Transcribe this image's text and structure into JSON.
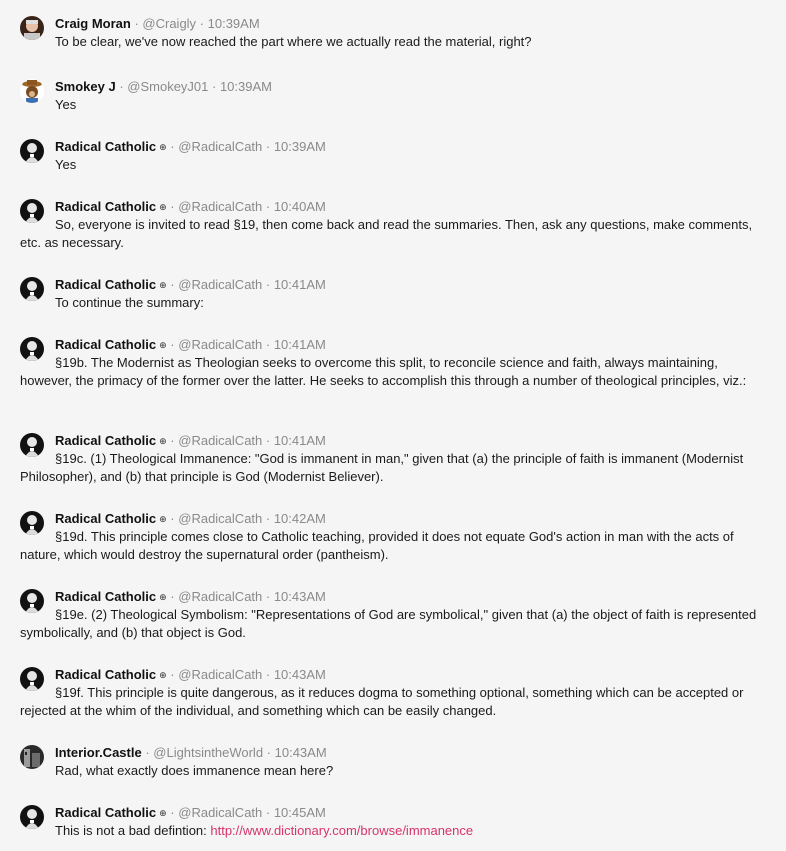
{
  "posts": [
    {
      "author": "Craig Moran",
      "badge": "",
      "handle": "@Craigly",
      "time": "10:39AM",
      "avatar": "craig-avatar",
      "text": "To be clear, we've now reached the part where we actually read the material, right?"
    },
    {
      "author": "Smokey J",
      "badge": "",
      "handle": "@SmokeyJ01",
      "time": "10:39AM",
      "avatar": "smokey-bear-avatar",
      "text": "Yes"
    },
    {
      "author": "Radical Catholic",
      "badge": "⊕",
      "handle": "@RadicalCath",
      "time": "10:39AM",
      "avatar": "priest-avatar",
      "text": "Yes"
    },
    {
      "author": "Radical Catholic",
      "badge": "⊕",
      "handle": "@RadicalCath",
      "time": "10:40AM",
      "avatar": "priest-avatar",
      "text": "So, everyone is invited to read §19, then come back and read the summaries. Then, ask any questions, make comments, etc. as necessary."
    },
    {
      "author": "Radical Catholic",
      "badge": "⊕",
      "handle": "@RadicalCath",
      "time": "10:41AM",
      "avatar": "priest-avatar",
      "text": "To continue the summary:"
    },
    {
      "author": "Radical Catholic",
      "badge": "⊕",
      "handle": "@RadicalCath",
      "time": "10:41AM",
      "avatar": "priest-avatar",
      "text": "§19b. The Modernist as Theologian seeks to overcome this split, to reconcile science and faith, always maintaining, however, the primacy of the former over the latter. He seeks to accomplish this through a number of theological principles, viz.:"
    },
    {
      "author": "Radical Catholic",
      "badge": "⊕",
      "handle": "@RadicalCath",
      "time": "10:41AM",
      "avatar": "priest-avatar",
      "text": "§19c. (1) Theological Immanence: \"God is immanent in man,\" given that (a) the principle of faith is immanent (Modernist Philosopher), and (b) that principle is God (Modernist Believer)."
    },
    {
      "author": "Radical Catholic",
      "badge": "⊕",
      "handle": "@RadicalCath",
      "time": "10:42AM",
      "avatar": "priest-avatar",
      "text": "§19d. This principle comes close to Catholic teaching, provided it does not equate God's action in man with the acts of nature, which would destroy the supernatural order (pantheism)."
    },
    {
      "author": "Radical Catholic",
      "badge": "⊕",
      "handle": "@RadicalCath",
      "time": "10:43AM",
      "avatar": "priest-avatar",
      "text": "§19e. (2) Theological Symbolism: \"Representations of God are symbolical,\" given that (a) the object of faith is represented symbolically, and (b) that object is God."
    },
    {
      "author": "Radical Catholic",
      "badge": "⊕",
      "handle": "@RadicalCath",
      "time": "10:43AM",
      "avatar": "priest-avatar",
      "text": "§19f. This principle is quite dangerous, as it reduces dogma to something optional, something which can be accepted or rejected at the whim of the individual, and something which can be easily changed."
    },
    {
      "author": "Interior.Castle",
      "badge": "",
      "handle": "@LightsintheWorld",
      "time": "10:43AM",
      "avatar": "castle-avatar",
      "text": "Rad, what exactly does immanence mean here?"
    },
    {
      "author": "Radical Catholic",
      "badge": "⊕",
      "handle": "@RadicalCath",
      "time": "10:45AM",
      "avatar": "priest-avatar",
      "text": "This is not a bad defintion: ",
      "link": "http://www.dictionary.com/browse/immanence"
    }
  ],
  "separator": " · ",
  "colors": {
    "background": "#f5f5f5",
    "meta": "#8a8a8a",
    "link": "#d6336c"
  }
}
